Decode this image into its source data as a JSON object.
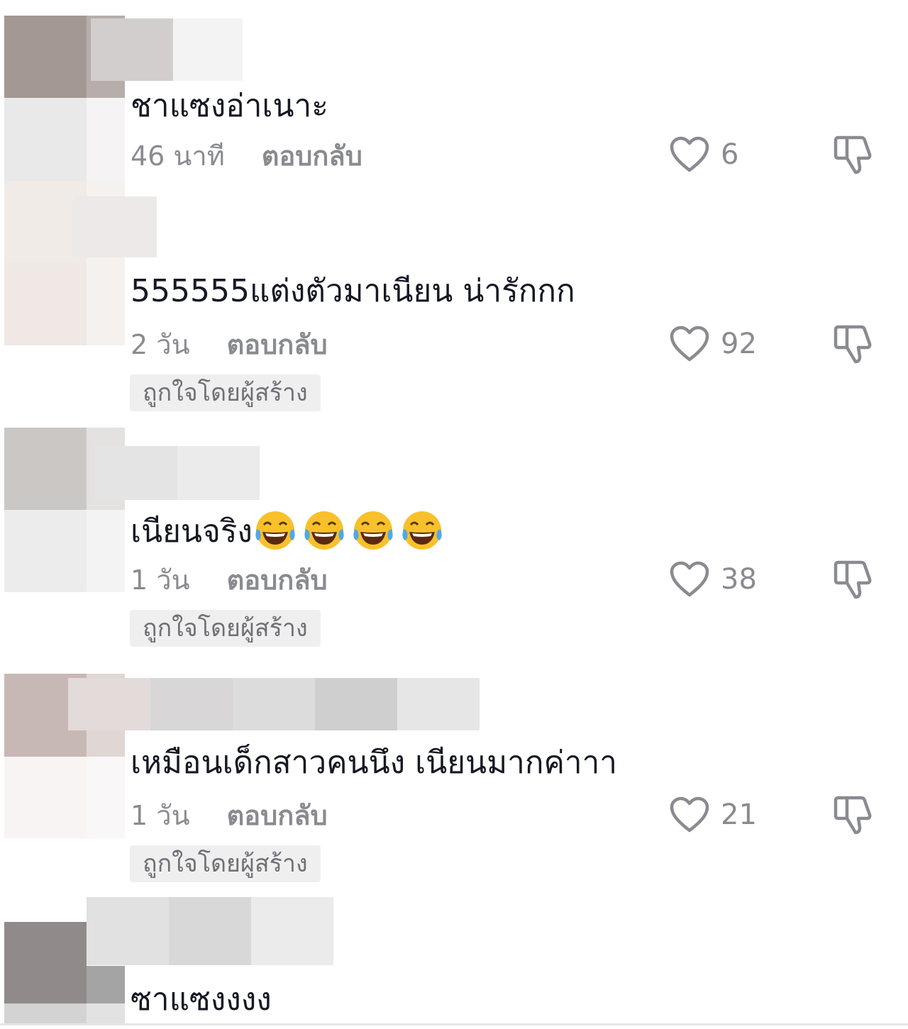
{
  "comments": [
    {
      "text": "ชาแซงอ่าเนาะ",
      "time": "46 นาที",
      "reply": "ตอบกลับ",
      "likes": "6",
      "badge": ""
    },
    {
      "text": "555555แต่งตัวมาเนียน น่ารักกก",
      "time": "2 วัน",
      "reply": "ตอบกลับ",
      "likes": "92",
      "badge": "ถูกใจโดยผู้สร้าง"
    },
    {
      "text": "เนียนจริง",
      "time": "1 วัน",
      "reply": "ตอบกลับ",
      "likes": "38",
      "badge": "ถูกใจโดยผู้สร้าง"
    },
    {
      "text": "เหมือนเด็กสาวคนนึง เนียนมากค่าาา",
      "time": "1 วัน",
      "reply": "ตอบกลับ",
      "likes": "21",
      "badge": "ถูกใจโดยผู้สร้าง"
    },
    {
      "text": "ซาแซงงงง"
    }
  ],
  "icons": {
    "like": "heart-outline-icon",
    "dislike": "thumbs-down-icon",
    "emoji": "face-with-tears-of-joy-emoji"
  },
  "colors": {
    "text": "#161823",
    "meta": "#8a8b91",
    "badge_bg": "#efefef"
  }
}
